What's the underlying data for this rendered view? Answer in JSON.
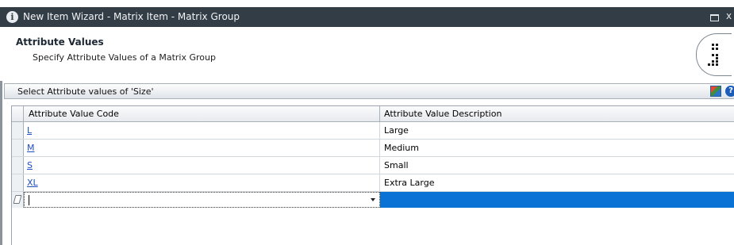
{
  "window": {
    "title": "New Item Wizard - Matrix Item - Matrix Group",
    "close_glyph": "x"
  },
  "header": {
    "title": "Attribute Values",
    "subtitle": "Specify Attribute Values  of a Matrix Group"
  },
  "group": {
    "label": "Select Attribute values of 'Size'"
  },
  "grid": {
    "columns": [
      "Attribute Value Code",
      "Attribute Value Description"
    ],
    "rows": [
      {
        "code": "L",
        "description": "Large"
      },
      {
        "code": "M",
        "description": "Medium"
      },
      {
        "code": "S",
        "description": "Small"
      },
      {
        "code": "XL",
        "description": "Extra Large"
      }
    ],
    "new_row": {
      "code": "",
      "description": ""
    }
  },
  "colors": {
    "titlebar": "#333d46",
    "selection": "#0a72d4",
    "link": "#1f4fbf"
  },
  "icons": [
    "info-icon",
    "minimize-icon",
    "close-icon",
    "logo-icon",
    "layout-icon",
    "help-icon",
    "pencil-icon",
    "dropdown-arrow-icon"
  ]
}
